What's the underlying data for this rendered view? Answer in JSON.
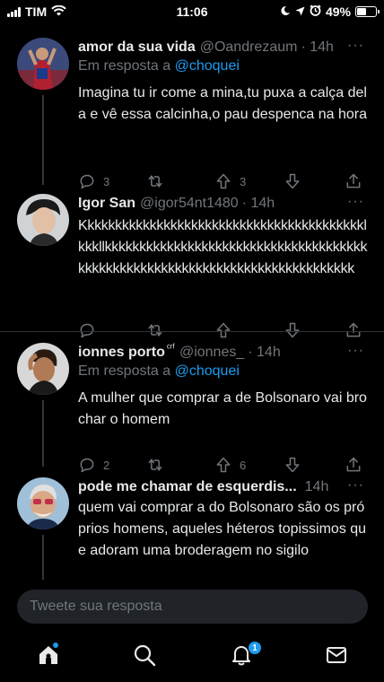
{
  "status": {
    "carrier": "TIM",
    "time": "11:06",
    "battery_percent": "49%",
    "battery_level": 0.49,
    "icons": [
      "signal-icon",
      "wifi-icon",
      "moon-icon",
      "location-icon",
      "alarm-icon",
      "battery-icon"
    ]
  },
  "tweets": [
    {
      "name": "amor da sua vida",
      "handle": "@Oandrezaum",
      "time": "· 14h",
      "reply_prefix": "Em resposta a",
      "reply_mention": "@choquei",
      "text": "Imagina tu ir come a mina,tu puxa a calça dela e vê essa calcinha,o pau despenca na hora",
      "replies": "3",
      "retweets": "",
      "likes": "3",
      "more": "···"
    },
    {
      "name": "Igor San",
      "handle": "@igor54nt1480",
      "time": "· 14h",
      "text": "Kkkkkkkkkkkkkkkkkkkkkkkkkkkkkkkkkkkkkkkkklkkkllkkkkkkkkkkkkkkkkkkkkkkkkkkkkkkkkkkkkkkkkkkkkkkkkkkkkkkkkkkkkkkkkkkkkkkkkkkkkkk",
      "replies": "",
      "retweets": "",
      "likes": "",
      "more": "···"
    },
    {
      "name": "ionnes porto",
      "name_suffix": "ᶜʳᶠ",
      "handle": "@ionnes_",
      "time": "· 14h",
      "reply_prefix": "Em resposta a",
      "reply_mention": "@choquei",
      "text": "A mulher que comprar a de Bolsonaro vai brochar o homem",
      "replies": "2",
      "retweets": "",
      "likes": "6",
      "more": "···"
    },
    {
      "name": "pode me chamar de esquerdis...",
      "handle": "",
      "time": "14h",
      "text": "quem vai comprar a do Bolsonaro são os próprios homens, aqueles héteros topissimos que adoram uma broderagem no sigilo",
      "more": "···"
    }
  ],
  "reply_input": {
    "placeholder": "Tweete sua resposta"
  },
  "tabbar": {
    "tabs": [
      "home-icon",
      "search-icon",
      "notifications-icon",
      "messages-icon"
    ],
    "notif_count": "1"
  },
  "colors": {
    "background": "#000000",
    "accent": "#1d9bf0",
    "text": "#e7e9ea",
    "muted": "#71767b",
    "divider": "#2f3336",
    "input_bg": "#202327"
  }
}
